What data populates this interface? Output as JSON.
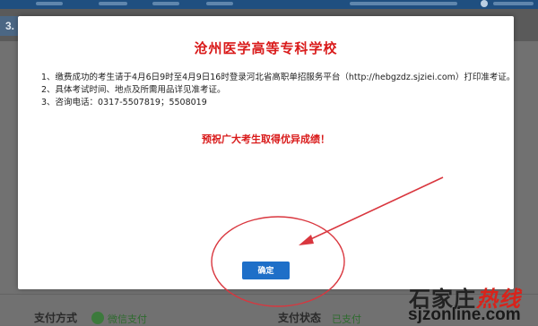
{
  "background": {
    "step_number": "3.",
    "left_label": "支付方式",
    "pay_method": "微信支付",
    "right_label": "支付状态",
    "pay_status": "已支付"
  },
  "modal": {
    "title": "沧州医学高等专科学校",
    "notices": [
      "1、缴费成功的考生请于4月6日9时至4月9日16时登录河北省高职单招服务平台（http://hebgzdz.sjziei.com）打印准考证。",
      "2、具体考试时间、地点及所需用品详见准考证。",
      "3、咨询电话：0317-5507819；5508019"
    ],
    "wish": "预祝广大考生取得优异成绩！",
    "confirm_label": "确定"
  },
  "watermark": {
    "brand_plain": "石家庄",
    "brand_hot": "热线",
    "domain": "sjzonline.com"
  },
  "colors": {
    "accent_red": "#d91a1a",
    "button_blue": "#1e6fc8",
    "annotation_red": "#d9363e"
  }
}
